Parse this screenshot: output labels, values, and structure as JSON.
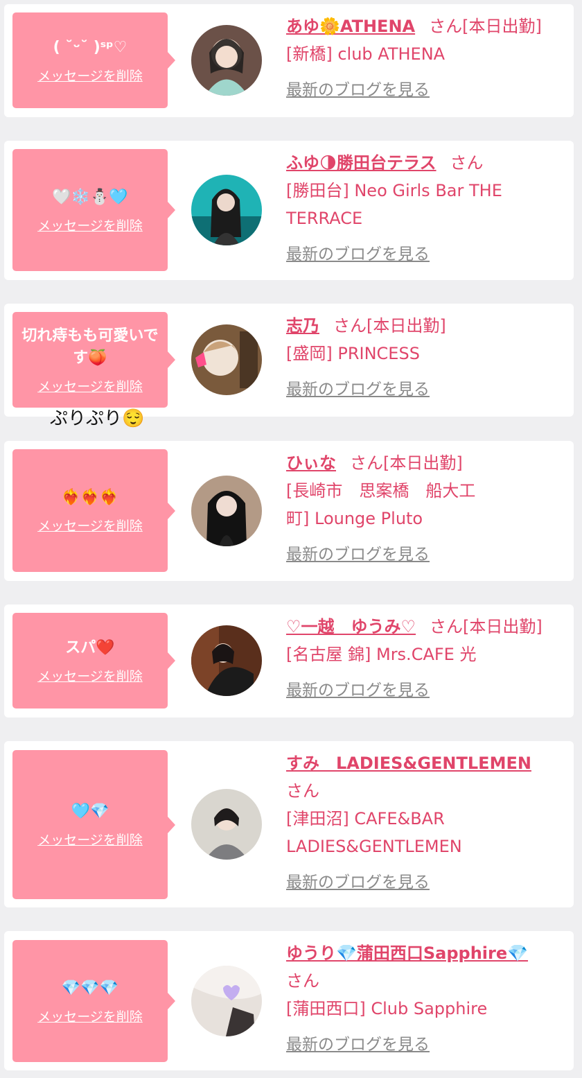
{
  "cards": [
    {
      "message": "( ˘ᵕ˘ )ˢᵖ♡",
      "delete_label": "メッセージを削除",
      "name": "あゆ🌼ATHENA",
      "san": "さん",
      "badge": "[本日出勤]",
      "shop_lines": [
        "[新橋] club ATHENA"
      ],
      "blog_label": "最新のブログを見る"
    },
    {
      "message": "🤍❄️⛄🩵",
      "delete_label": "メッセージを削除",
      "name": "ふゆ🌗勝田台テラス",
      "san": "さん",
      "badge": "",
      "shop_lines": [
        "[勝田台] Neo Girls Bar THE",
        "TERRACE"
      ],
      "blog_label": "最新のブログを見る"
    },
    {
      "message": "切れ痔もも可愛いです🍑",
      "delete_label": "メッセージを削除",
      "name": "志乃",
      "san": "さん",
      "badge": "[本日出勤]",
      "shop_lines": [
        "[盛岡] PRINCESS"
      ],
      "blog_label": "最新のブログを見る"
    },
    {
      "message": "❤️‍🔥❤️‍🔥❤️‍🔥",
      "delete_label": "メッセージを削除",
      "name": "ひぃな",
      "san": "さん",
      "badge": "[本日出勤]",
      "shop_lines": [
        "[長崎市　思案橋　船大工",
        "町] Lounge Pluto"
      ],
      "blog_label": "最新のブログを見る"
    },
    {
      "message": "スパ❤️",
      "delete_label": "メッセージを削除",
      "name": "♡一越　ゆうみ♡",
      "san": "さん",
      "badge": "[本日出勤]",
      "shop_lines": [
        "[名古屋 錦] Mrs.CAFE 光"
      ],
      "blog_label": "最新のブログを見る"
    },
    {
      "message": "🩵💎",
      "delete_label": "メッセージを削除",
      "name": "すみ　LADIES&GENTLEMEN",
      "san": "さん",
      "badge": "",
      "shop_lines": [
        "[津田沼] CAFE&BAR",
        "LADIES&GENTLEMEN"
      ],
      "blog_label": "最新のブログを見る"
    },
    {
      "message": "💎💎💎",
      "delete_label": "メッセージを削除",
      "name": "ゆうり💎蒲田西口Sapphire💎",
      "san": "さん",
      "badge": "",
      "shop_lines": [
        "[蒲田西口] Club Sapphire"
      ],
      "blog_label": "最新のブログを見る"
    }
  ],
  "overlay_text": "ぷりぷり😌",
  "colors": {
    "accent": "#e0456a",
    "bubble": "#ff95a6",
    "background": "#efeff1",
    "muted": "#8a8a8a"
  }
}
